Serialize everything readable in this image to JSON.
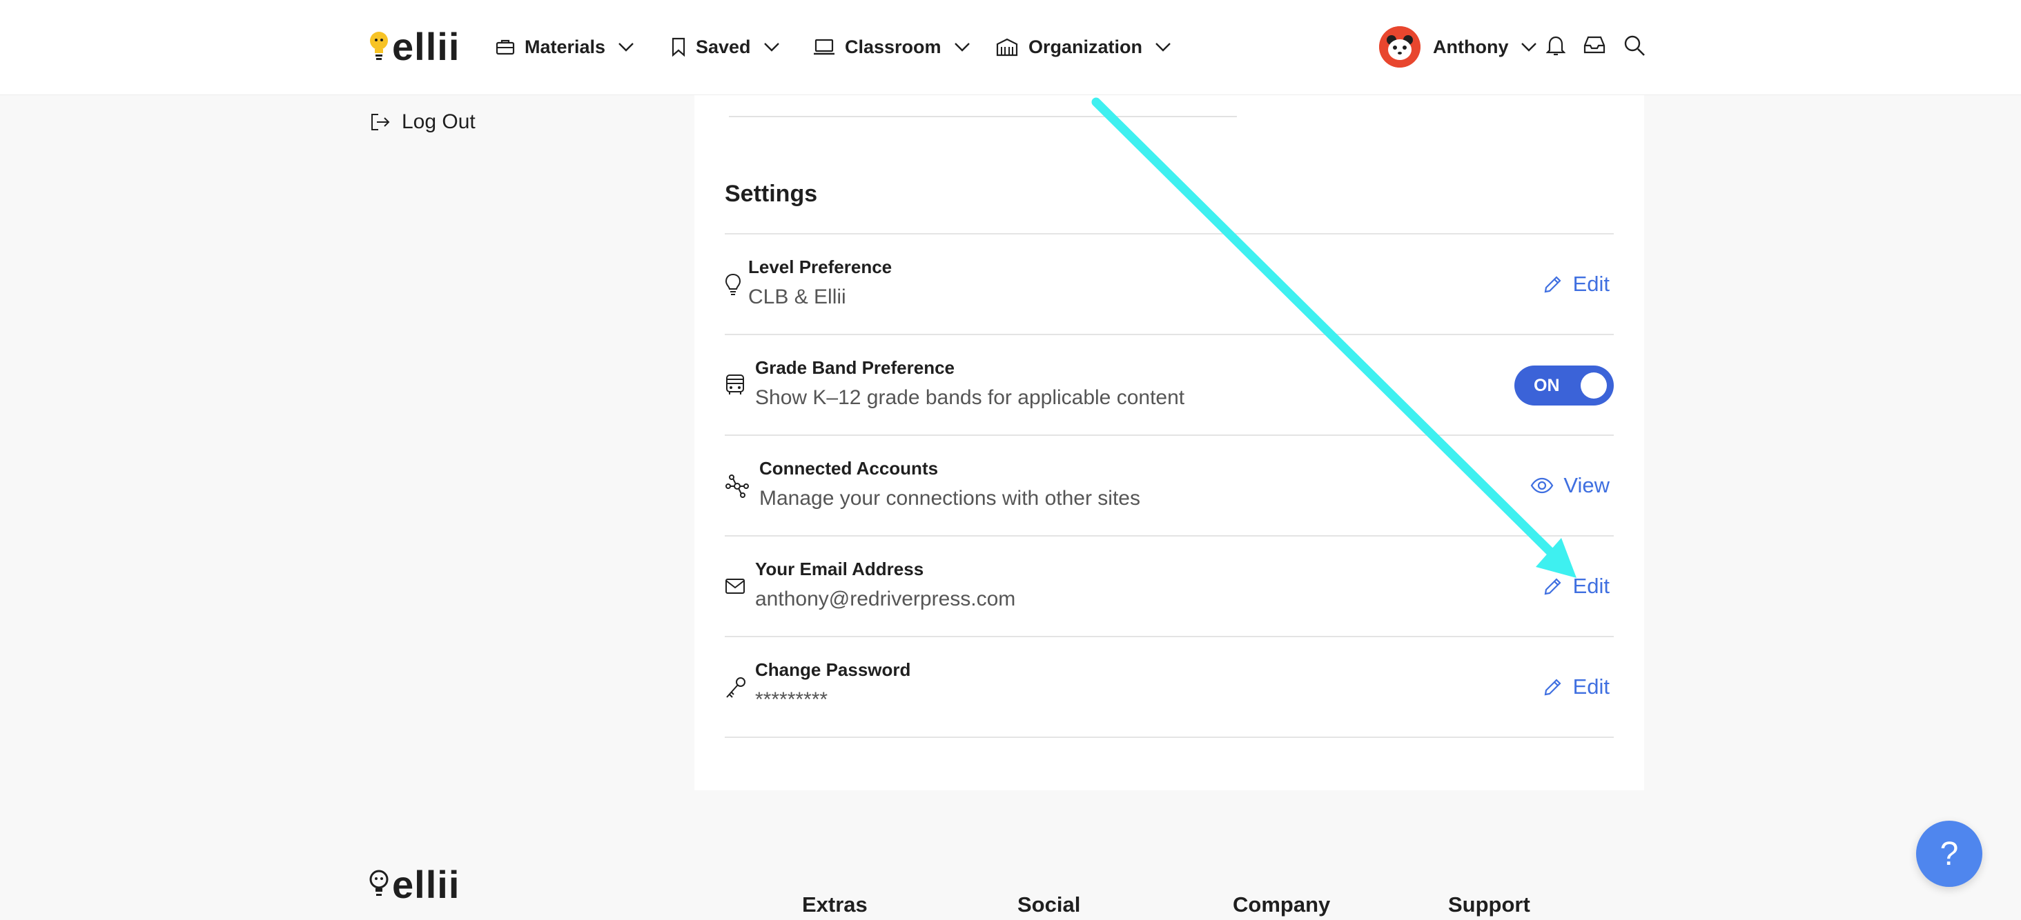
{
  "brand": {
    "logo_text": "ellii"
  },
  "header": {
    "nav": [
      {
        "label": "Materials",
        "icon": "briefcase-icon"
      },
      {
        "label": "Saved",
        "icon": "bookmark-icon"
      },
      {
        "label": "Classroom",
        "icon": "laptop-icon"
      },
      {
        "label": "Organization",
        "icon": "building-icon"
      }
    ],
    "user_name": "Anthony"
  },
  "sidebar": {
    "logout_label": "Log Out"
  },
  "settings": {
    "title": "Settings",
    "rows": [
      {
        "label": "Level Preference",
        "value": "CLB & Ellii",
        "action": "Edit",
        "icon": "lightbulb-icon"
      },
      {
        "label": "Grade Band Preference",
        "value": "Show K–12 grade bands for applicable content",
        "toggle_label": "ON",
        "toggle_on": true,
        "icon": "bus-icon"
      },
      {
        "label": "Connected Accounts",
        "value": "Manage your connections with other sites",
        "action": "View",
        "icon": "network-icon"
      },
      {
        "label": "Your Email Address",
        "value": "anthony@redriverpress.com",
        "action": "Edit",
        "icon": "envelope-icon"
      },
      {
        "label": "Change Password",
        "value": "*********",
        "action": "Edit",
        "icon": "key-icon"
      }
    ]
  },
  "footer": {
    "logo_text": "ellii",
    "columns": [
      "Extras",
      "Social",
      "Company",
      "Support"
    ]
  },
  "help": {
    "label": "?"
  },
  "colors": {
    "accent": "#3f6fe0",
    "toggle": "#3b63d8",
    "arrow": "#3ef0f0",
    "help": "#4f86ee"
  }
}
